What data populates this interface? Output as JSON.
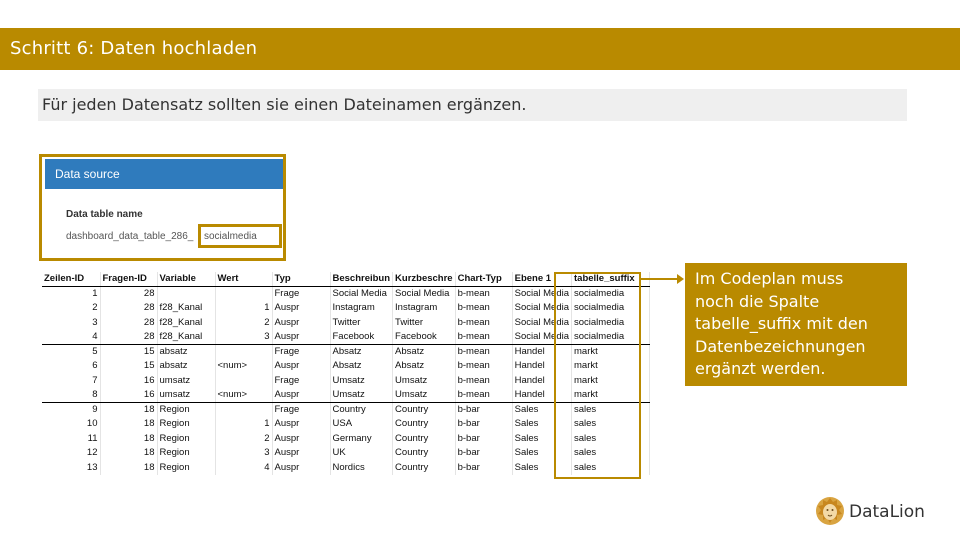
{
  "slide": {
    "title": "Schritt 6: Daten hochladen",
    "subtitle": "Für jeden Datensatz sollten sie einen Dateinamen ergänzen."
  },
  "data_source": {
    "header": "Data source",
    "field_label": "Data table name",
    "prefix": "dashboard_data_table_286_",
    "input_value": "socialmedia"
  },
  "table": {
    "headers": [
      "Zeilen-ID",
      "Fragen-ID",
      "Variable",
      "Wert",
      "Typ",
      "Beschreibun",
      "Kurzbeschre",
      "Chart-Typ",
      "Ebene 1",
      "tabelle_suffix"
    ],
    "rows": [
      [
        "1",
        "28",
        "",
        "",
        "Frage",
        "Social Media",
        "Social Media",
        "b-mean",
        "Social Media",
        "socialmedia"
      ],
      [
        "2",
        "28",
        "f28_Kanal",
        "1",
        "Auspr",
        "Instagram",
        "Instagram",
        "b-mean",
        "Social Media",
        "socialmedia"
      ],
      [
        "3",
        "28",
        "f28_Kanal",
        "2",
        "Auspr",
        "Twitter",
        "Twitter",
        "b-mean",
        "Social Media",
        "socialmedia"
      ],
      [
        "4",
        "28",
        "f28_Kanal",
        "3",
        "Auspr",
        "Facebook",
        "Facebook",
        "b-mean",
        "Social Media",
        "socialmedia"
      ],
      [
        "5",
        "15",
        "absatz",
        "",
        "Frage",
        "Absatz",
        "Absatz",
        "b-mean",
        "Handel",
        "markt"
      ],
      [
        "6",
        "15",
        "absatz",
        "<num>",
        "Auspr",
        "Absatz",
        "Absatz",
        "b-mean",
        "Handel",
        "markt"
      ],
      [
        "7",
        "16",
        "umsatz",
        "",
        "Frage",
        "Umsatz",
        "Umsatz",
        "b-mean",
        "Handel",
        "markt"
      ],
      [
        "8",
        "16",
        "umsatz",
        "<num>",
        "Auspr",
        "Umsatz",
        "Umsatz",
        "b-mean",
        "Handel",
        "markt"
      ],
      [
        "9",
        "18",
        "Region",
        "",
        "Frage",
        "Country",
        "Country",
        "b-bar",
        "Sales",
        "sales"
      ],
      [
        "10",
        "18",
        "Region",
        "1",
        "Auspr",
        "USA",
        "Country",
        "b-bar",
        "Sales",
        "sales"
      ],
      [
        "11",
        "18",
        "Region",
        "2",
        "Auspr",
        "Germany",
        "Country",
        "b-bar",
        "Sales",
        "sales"
      ],
      [
        "12",
        "18",
        "Region",
        "3",
        "Auspr",
        "UK",
        "Country",
        "b-bar",
        "Sales",
        "sales"
      ],
      [
        "13",
        "18",
        "Region",
        "4",
        "Auspr",
        "Nordics",
        "Country",
        "b-bar",
        "Sales",
        "sales"
      ]
    ]
  },
  "callout": {
    "lines": [
      "Im Codeplan muss",
      "noch die Spalte",
      "tabelle_suffix mit den",
      "Datenbezeichnungen",
      "ergänzt werden."
    ]
  },
  "logo": {
    "text": "DataLion",
    "icon": "lion-icon"
  },
  "colors": {
    "accent": "#b98a00",
    "panel_header": "#2f7bbd"
  }
}
